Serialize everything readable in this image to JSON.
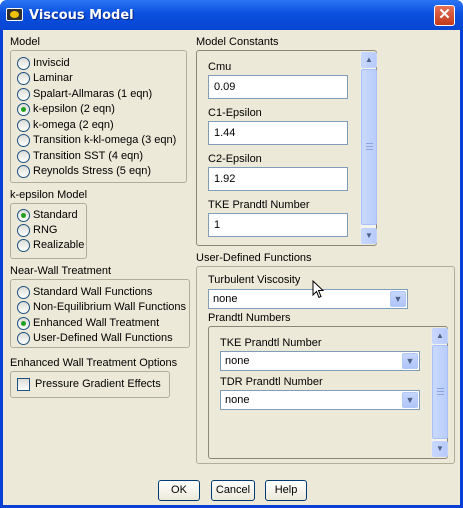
{
  "window": {
    "title": "Viscous Model"
  },
  "model": {
    "label": "Model",
    "options": [
      "Inviscid",
      "Laminar",
      "Spalart-Allmaras (1 eqn)",
      "k-epsilon (2 eqn)",
      "k-omega (2 eqn)",
      "Transition k-kl-omega (3 eqn)",
      "Transition SST (4 eqn)",
      "Reynolds Stress (5 eqn)"
    ],
    "selected": "k-epsilon (2 eqn)"
  },
  "ke_model": {
    "label": "k-epsilon Model",
    "options": [
      "Standard",
      "RNG",
      "Realizable"
    ],
    "selected": "Standard"
  },
  "near_wall": {
    "label": "Near-Wall Treatment",
    "options": [
      "Standard Wall Functions",
      "Non-Equilibrium Wall Functions",
      "Enhanced Wall Treatment",
      "User-Defined Wall Functions"
    ],
    "selected": "Enhanced Wall Treatment"
  },
  "ewt_options": {
    "label": "Enhanced Wall Treatment Options",
    "checkbox_label": "Pressure Gradient Effects",
    "checked": false
  },
  "constants": {
    "label": "Model Constants",
    "fields": [
      {
        "label": "Cmu",
        "value": "0.09"
      },
      {
        "label": "C1-Epsilon",
        "value": "1.44"
      },
      {
        "label": "C2-Epsilon",
        "value": "1.92"
      },
      {
        "label": "TKE Prandtl Number",
        "value": "1"
      }
    ]
  },
  "udf": {
    "label": "User-Defined Functions",
    "turbulent_viscosity": {
      "label": "Turbulent Viscosity",
      "value": "none"
    },
    "prandtl": {
      "label": "Prandtl Numbers",
      "tke": {
        "label": "TKE Prandtl Number",
        "value": "none"
      },
      "tdr": {
        "label": "TDR Prandtl Number",
        "value": "none"
      }
    }
  },
  "buttons": {
    "ok": "OK",
    "cancel": "Cancel",
    "help": "Help"
  },
  "icons": {
    "scroll_up": "scroll-up-arrow-icon",
    "scroll_down": "scroll-down-arrow-icon",
    "dropdown": "chevron-down-icon",
    "close": "close-icon"
  }
}
